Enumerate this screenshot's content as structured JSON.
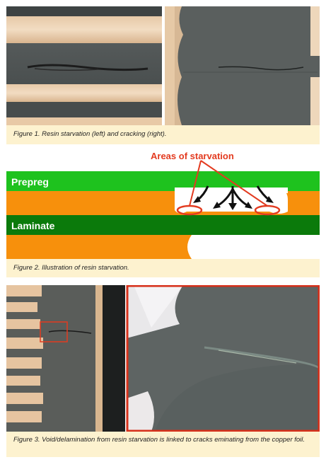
{
  "figure1": {
    "caption": "Figure 1. Resin starvation (left) and cracking (right)."
  },
  "figure2": {
    "callout": "Areas of starvation",
    "layer_prepreg": "Prepreg",
    "layer_laminate": "Laminate",
    "caption": "Figure 2. Illustration of resin starvation.",
    "colors": {
      "prepreg": "#1ec21e",
      "laminate": "#0b7a0b",
      "core": "#f7900c",
      "callout": "#e33b20",
      "arrows": "#111111"
    }
  },
  "figure3": {
    "caption": "Figure 3. Void/delamination from resin starvation is linked to cracks eminating from the copper foil."
  }
}
